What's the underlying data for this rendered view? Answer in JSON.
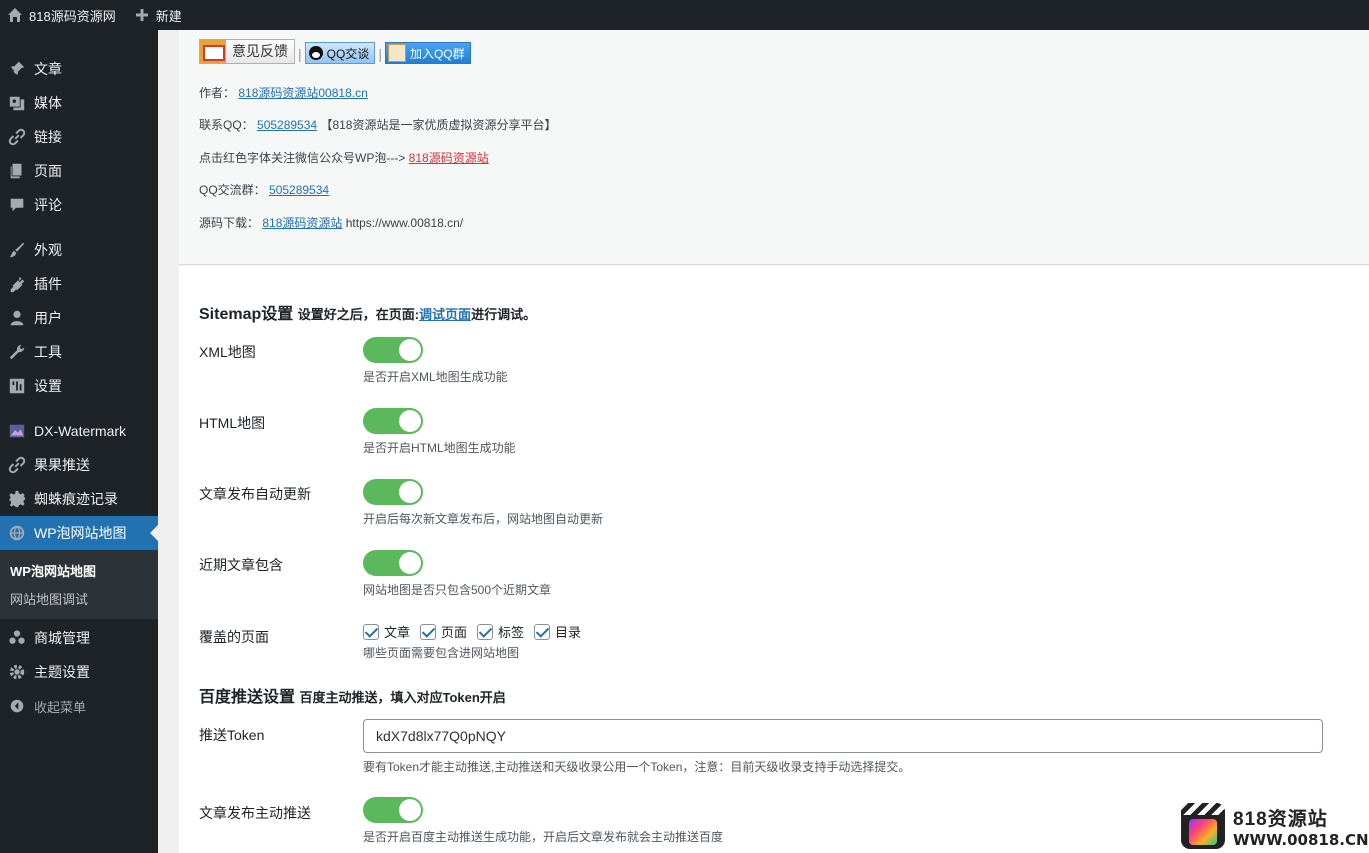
{
  "adminbar": {
    "site_name": "818源码资源网",
    "new_label": "新建"
  },
  "sidebar": {
    "items": [
      {
        "label": "文章",
        "icon": "pin-icon"
      },
      {
        "label": "媒体",
        "icon": "media-icon"
      },
      {
        "label": "链接",
        "icon": "link-icon"
      },
      {
        "label": "页面",
        "icon": "page-icon"
      },
      {
        "label": "评论",
        "icon": "comment-icon"
      },
      {
        "label": "外观",
        "icon": "brush-icon"
      },
      {
        "label": "插件",
        "icon": "plugin-icon"
      },
      {
        "label": "用户",
        "icon": "user-icon"
      },
      {
        "label": "工具",
        "icon": "wrench-icon"
      },
      {
        "label": "设置",
        "icon": "settings-icon"
      },
      {
        "label": "DX-Watermark",
        "icon": "image-icon"
      },
      {
        "label": "果果推送",
        "icon": "link-icon"
      },
      {
        "label": "蜘蛛痕迹记录",
        "icon": "gear-icon"
      },
      {
        "label": "WP泡网站地图",
        "icon": "globe-icon"
      },
      {
        "label": "商城管理",
        "icon": "group-icon"
      },
      {
        "label": "主题设置",
        "icon": "gear-icon"
      }
    ],
    "submenu": [
      {
        "label": "WP泡网站地图"
      },
      {
        "label": "网站地图调试"
      }
    ],
    "collapse_label": "收起菜单"
  },
  "top_panel": {
    "feedback_button": "意见反馈",
    "qq_chat_button": "QQ交谈",
    "join_group_button": "加入QQ群",
    "separator": "|",
    "author_label": "作者：",
    "author_link": "818源码资源站00818.cn",
    "qq_label": "联系QQ：",
    "qq_number": "505289534",
    "qq_note": "【818资源站是一家优质虚拟资源分享平台】",
    "wechat_text": "点击红色字体关注微信公众号WP泡--->",
    "wechat_link": "818源码资源站",
    "group_label": "QQ交流群：",
    "group_number": "505289534",
    "download_label": "源码下载：",
    "download_link": "818源码资源站",
    "download_url": "https://www.00818.cn/"
  },
  "sitemap": {
    "title": "Sitemap设置",
    "subtitle_prefix": "设置好之后，在页面:",
    "subtitle_link": "调试页面",
    "subtitle_suffix": "进行调试。",
    "xml_label": "XML地图",
    "xml_on": true,
    "xml_desc": "是否开启XML地图生成功能",
    "html_label": "HTML地图",
    "html_on": true,
    "html_desc": "是否开启HTML地图生成功能",
    "auto_update_label": "文章发布自动更新",
    "auto_update_on": true,
    "auto_update_desc": "开启后每次新文章发布后，网站地图自动更新",
    "recent_label": "近期文章包含",
    "recent_on": true,
    "recent_desc": "网站地图是否只包含500个近期文章",
    "pages_label": "覆盖的页面",
    "checkboxes": [
      {
        "label": "文章",
        "checked": true
      },
      {
        "label": "页面",
        "checked": true
      },
      {
        "label": "标签",
        "checked": true
      },
      {
        "label": "目录",
        "checked": true
      }
    ],
    "pages_desc": "哪些页面需要包含进网站地图"
  },
  "baidu": {
    "title": "百度推送设置",
    "subtitle": "百度主动推送，填入对应Token开启",
    "token_label": "推送Token",
    "token_value": "kdX7d8lx77Q0pNQY",
    "token_desc": "要有Token才能主动推送,主动推送和天级收录公用一个Token，注意：目前天级收录支持手动选择提交。",
    "push_label": "文章发布主动推送",
    "push_on": true,
    "push_desc": "是否开启百度主动推送生成功能，开启后文章发布就会主动推送百度"
  },
  "watermark": {
    "title": "818资源站",
    "url": "WWW.00818.CN"
  },
  "colors": {
    "sidebar_bg": "#1d2327",
    "active": "#2271b1",
    "toggle_on": "#5cb85c",
    "link": "#2271b1",
    "red_link": "#d63638"
  }
}
